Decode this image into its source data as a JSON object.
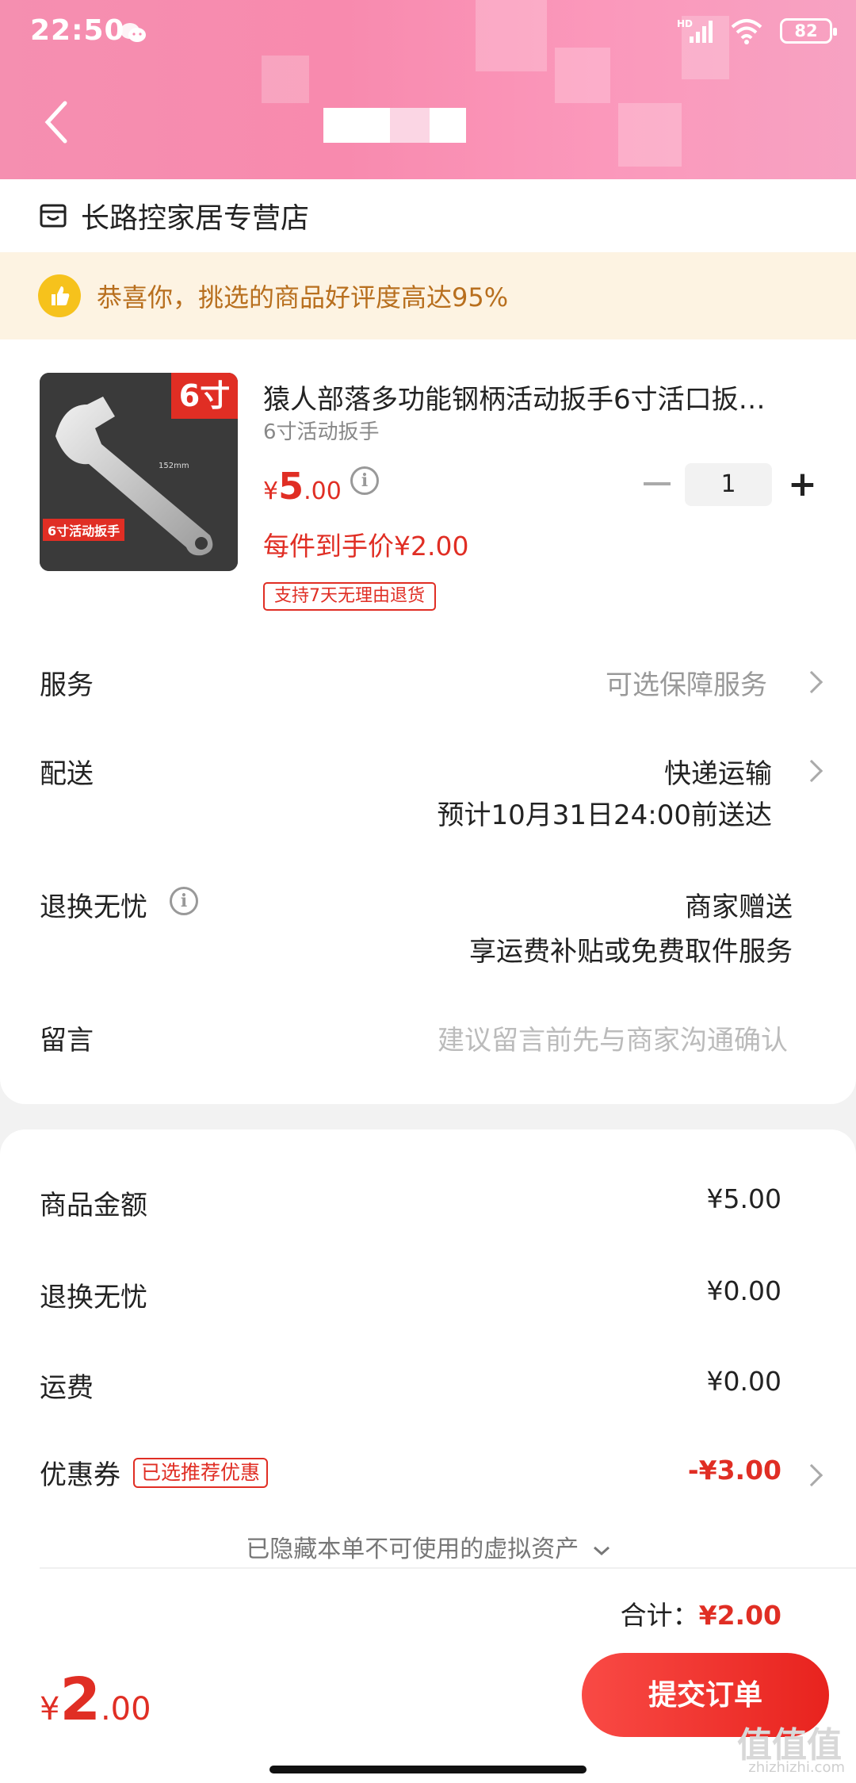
{
  "status_bar": {
    "time": "22:50",
    "network": "HD",
    "battery": "82"
  },
  "header": {
    "back_icon": "chevron-left-icon"
  },
  "store": {
    "name": "长路控家居专营店",
    "icon": "store-icon"
  },
  "banner": {
    "text": "恭喜你，挑选的商品好评度高达95%",
    "icon": "thumbs-up-icon"
  },
  "product": {
    "image_badge": "6寸",
    "image_label": "6寸活动扳手",
    "title": "猿人部落多功能钢柄活动扳手6寸活口扳…",
    "spec": "6寸活动扳手",
    "price_symbol": "¥",
    "price_int": "5",
    "price_dec": ".00",
    "final_price": "每件到手价¥2.00",
    "return_tag": "支持7天无理由退货",
    "quantity": "1"
  },
  "rows": {
    "service_label": "服务",
    "service_value": "可选保障服务",
    "delivery_label": "配送",
    "delivery_value": "快递运输",
    "delivery_eta": "预计10月31日24:00前送达",
    "return_label": "退换无忧",
    "return_value": "商家赠送",
    "return_desc": "享运费补贴或免费取件服务",
    "message_label": "留言",
    "message_placeholder": "建议留言前先与商家沟通确认"
  },
  "summary": {
    "goods_label": "商品金额",
    "goods_value": "¥5.00",
    "return_label": "退换无忧",
    "return_value": "¥0.00",
    "shipping_label": "运费",
    "shipping_value": "¥0.00",
    "coupon_label": "优惠券",
    "coupon_tag": "已选推荐优惠",
    "coupon_value": "-¥3.00",
    "hidden_note": "已隐藏本单不可使用的虚拟资产",
    "total_label": "合计：",
    "total_value": "¥2.00"
  },
  "bottom": {
    "price_symbol": "¥",
    "price_int": "2",
    "price_dec": ".00",
    "submit_label": "提交订单"
  },
  "watermark": {
    "main": "值值值",
    "sub": "zhizhizhi.com"
  },
  "colors": {
    "accent": "#e02e24",
    "header_pink": "#f88aae",
    "banner_text": "#b86f1e"
  }
}
